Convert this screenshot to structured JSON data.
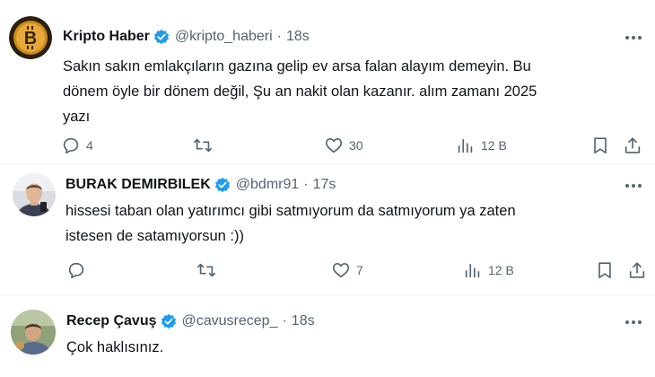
{
  "colors": {
    "text": "#0f1419",
    "muted": "#536471",
    "verified": "#1d9bf0",
    "divider": "#eff3f4"
  },
  "tweets": [
    {
      "name": "Kripto Haber",
      "handle": "@kripto_haberi",
      "dot": "·",
      "time": "18s",
      "avatar_icon": "bitcoin-logo-icon",
      "text_lines": [
        "Sakın sakın emlakçıların gazına gelip ev arsa falan alayım demeyin. Bu",
        "dönem öyle bir dönem değil, Şu an nakit olan kazanır. alım zamanı 2025",
        "yazı"
      ],
      "replies": "4",
      "retweets": "",
      "likes": "30",
      "views": "12 B"
    },
    {
      "name": "BURAK DEMIRBILEK",
      "handle": "@bdmr91",
      "dot": "·",
      "time": "17s",
      "avatar_icon": "user-photo-icon",
      "text_lines": [
        "hissesi taban olan yatırımcı gibi satmıyorum da satmıyorum ya zaten",
        "istesen de satamıyorsun :))"
      ],
      "replies": "",
      "retweets": "",
      "likes": "7",
      "views": "12 B"
    },
    {
      "name": "Recep Çavuş",
      "handle": "@cavusrecep_",
      "dot": "·",
      "time": "18s",
      "avatar_icon": "user-photo-icon",
      "text_lines": [
        "Çok haklısınız."
      ]
    }
  ]
}
